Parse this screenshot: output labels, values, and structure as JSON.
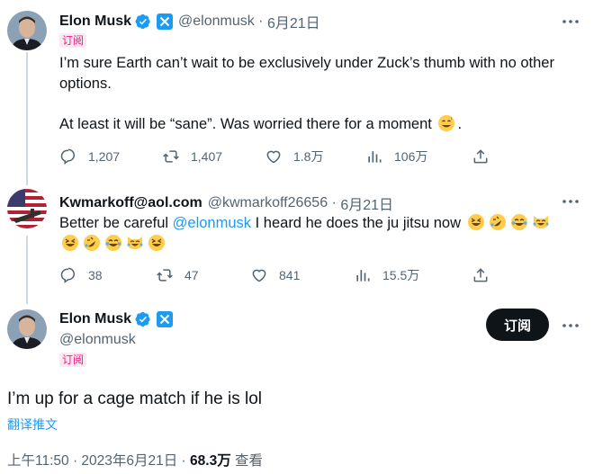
{
  "colors": {
    "accent": "#1d9bf0",
    "verified": "#1d9bf0",
    "subscribe_pink": "#f91880",
    "text": "#0f1419",
    "muted": "#536471"
  },
  "tweet1": {
    "name": "Elon Musk",
    "handle": "@elonmusk",
    "date": "6月21日",
    "subscribe_badge": "订阅",
    "text_line1": "I’m sure Earth can’t wait to be exclusively under Zuck’s thumb with no other options.",
    "text_line2": "At least it will be “sane”. Was worried there for a moment",
    "text_line2_end": ".",
    "emoji": "sweat-smile-emoji",
    "replies": "1,207",
    "retweets": "1,407",
    "likes": "1.8万",
    "views": "106万"
  },
  "tweet2": {
    "name": "Kwmarkoff@aol.com",
    "handle": "@kwmarkoff26656",
    "date": "6月21日",
    "text_before": "Better be careful ",
    "mention": "@elonmusk",
    "text_after": " I heard he does the ju jitsu now",
    "replies": "38",
    "retweets": "47",
    "likes": "841",
    "views": "15.5万"
  },
  "main": {
    "name": "Elon Musk",
    "handle": "@elonmusk",
    "subscribe_badge": "订阅",
    "subscribe_button": "订阅",
    "text": "I’m up for a cage match if he is lol",
    "translate": "翻译推文",
    "time_date": "上午11:50 · 2023年6月21日 · ",
    "views_count": "68.3万",
    "views_label": " 查看"
  }
}
